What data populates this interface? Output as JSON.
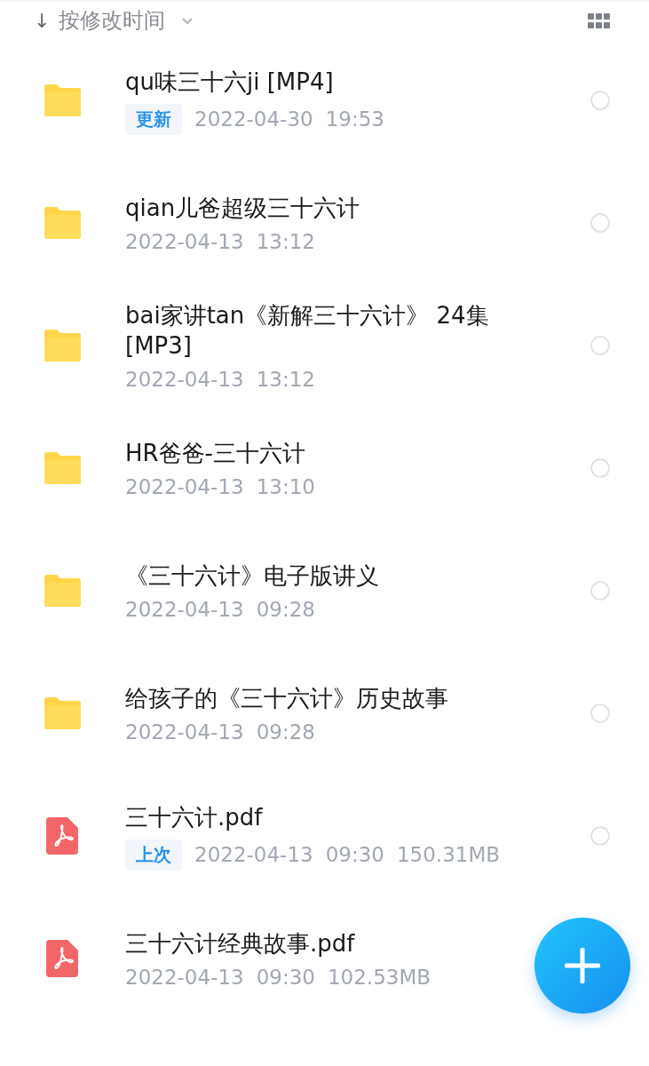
{
  "sort_bar": {
    "arrow": "↓",
    "label": "按修改时间"
  },
  "files": [
    {
      "kind": "folder",
      "name": "qu味三十六ji [MP4]",
      "tag": "更新",
      "date": "2022-04-30",
      "time": "19:53",
      "selected": false
    },
    {
      "kind": "folder",
      "name": "qian儿爸超级三十六计",
      "date": "2022-04-13",
      "time": "13:12",
      "selected": false
    },
    {
      "kind": "folder",
      "name": "bai家讲tan《新解三十六计》 24集 [MP3]",
      "date": "2022-04-13",
      "time": "13:12",
      "selected": false
    },
    {
      "kind": "folder",
      "name": "HR爸爸-三十六计",
      "date": "2022-04-13",
      "time": "13:10",
      "selected": false
    },
    {
      "kind": "folder",
      "name": "《三十六计》电子版讲义",
      "date": "2022-04-13",
      "time": "09:28",
      "selected": false
    },
    {
      "kind": "folder",
      "name": "给孩子的《三十六计》历史故事",
      "date": "2022-04-13",
      "time": "09:28",
      "selected": false
    },
    {
      "kind": "pdf",
      "name": "三十六计.pdf",
      "tag": "上次",
      "date": "2022-04-13",
      "time": "09:30",
      "size": "150.31MB",
      "selected": false
    },
    {
      "kind": "pdf",
      "name": "三十六计经典故事.pdf",
      "date": "2022-04-13",
      "time": "09:30",
      "size": "102.53MB"
    }
  ]
}
